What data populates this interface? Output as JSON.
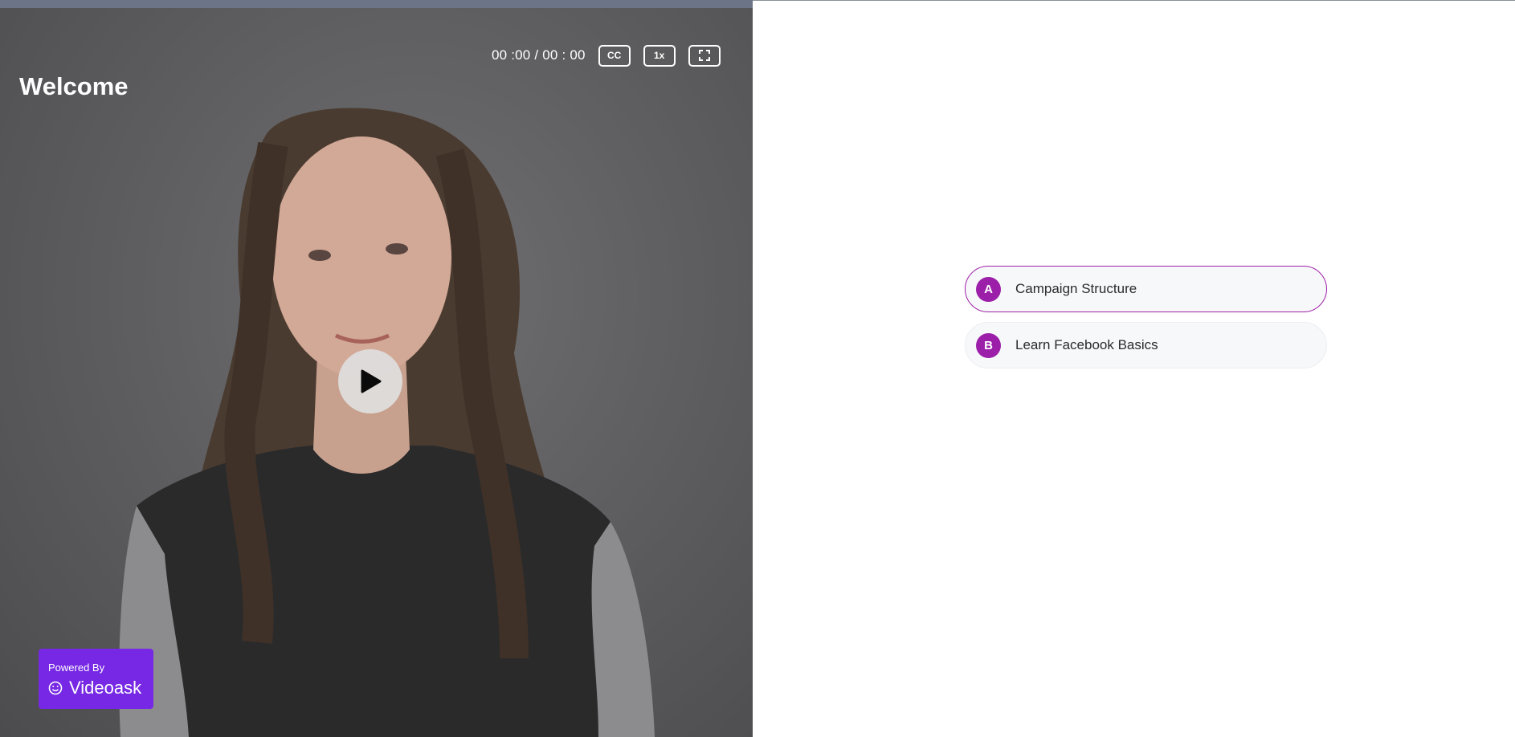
{
  "video": {
    "title": "Welcome",
    "time_display": "00 :00 / 00 : 00",
    "cc_label": "CC",
    "speed_label": "1x",
    "progress": 0
  },
  "branding": {
    "powered_by": "Powered By",
    "name": "Videoask",
    "color": "#7628e4"
  },
  "choices": [
    {
      "letter": "A",
      "label": "Campaign Structure",
      "selected": true
    },
    {
      "letter": "B",
      "label": "Learn Facebook Basics",
      "selected": false
    }
  ],
  "colors": {
    "accent": "#9b1fa8"
  }
}
